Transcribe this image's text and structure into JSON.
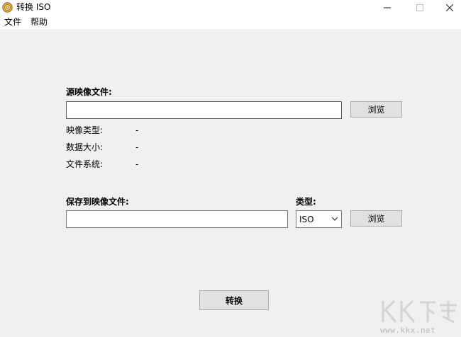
{
  "window": {
    "title": "转换 ISO",
    "icon": "disc-icon",
    "controls": {
      "minimize": "minimize-icon",
      "maximize": "maximize-icon",
      "close": "close-icon"
    }
  },
  "menu": {
    "items": [
      {
        "label": "文件"
      },
      {
        "label": "帮助"
      }
    ]
  },
  "source": {
    "heading": "源映像文件:",
    "path_value": "",
    "browse_label": "浏览",
    "info": [
      {
        "label": "映像类型:",
        "value": "-"
      },
      {
        "label": "数据大小:",
        "value": "-"
      },
      {
        "label": "文件系统:",
        "value": "-"
      }
    ]
  },
  "destination": {
    "heading": "保存到映像文件:",
    "path_value": "",
    "type_label": "类型:",
    "type_selected": "ISO",
    "browse_label": "浏览"
  },
  "convert_label": "转换",
  "watermark": {
    "logo_text": "KK下载",
    "url": "www.kkx.net"
  },
  "colors": {
    "client_bg": "#f0f0f0",
    "focus_border": "#0078d7",
    "button_bg": "#e1e1e1"
  }
}
